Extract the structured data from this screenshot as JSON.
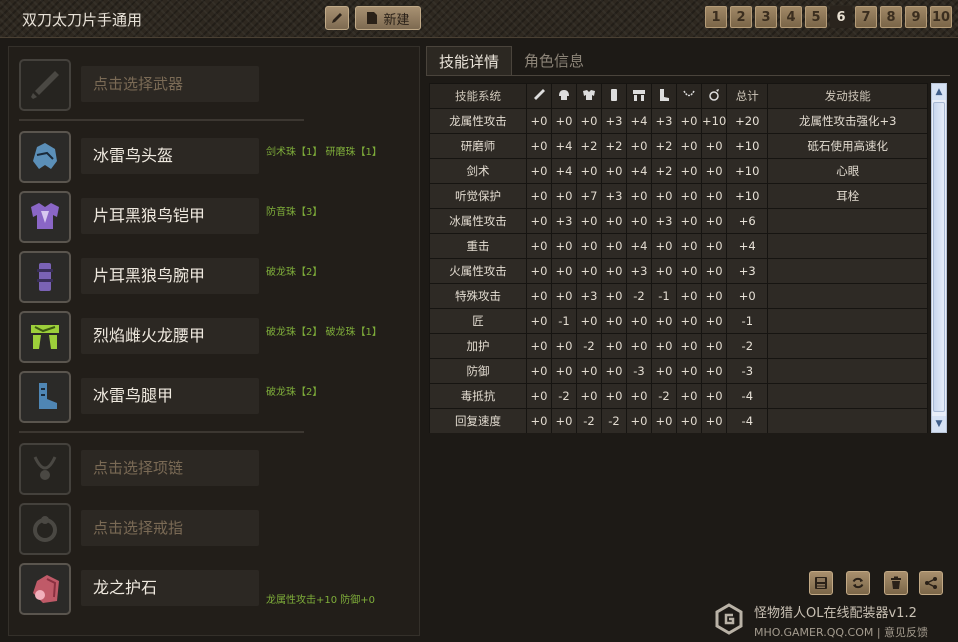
{
  "header": {
    "title": "双刀太刀片手通用",
    "new_label": "新建",
    "pages": [
      "1",
      "2",
      "3",
      "4",
      "5",
      "6",
      "7",
      "8",
      "9",
      "10"
    ],
    "active_page": "6"
  },
  "left": {
    "weapon": {
      "placeholder": "点击选择武器"
    },
    "armor": [
      {
        "name": "冰雷鸟头盔",
        "gems": "剑术珠【1】 研磨珠【1】",
        "color": "#5b8fb8"
      },
      {
        "name": "片耳黑狼鸟铠甲",
        "gems": "防音珠【3】",
        "color": "#8a66c6"
      },
      {
        "name": "片耳黑狼鸟腕甲",
        "gems": "破龙珠【2】",
        "color": "#7a62b5"
      },
      {
        "name": "烈焰雌火龙腰甲",
        "gems": "破龙珠【2】 破龙珠【1】",
        "color": "#9ccf3a"
      },
      {
        "name": "冰雷鸟腿甲",
        "gems": "破龙珠【2】",
        "color": "#4f86b4"
      }
    ],
    "necklace": {
      "placeholder": "点击选择项链"
    },
    "ring": {
      "placeholder": "点击选择戒指"
    },
    "charm": {
      "name": "龙之护石",
      "gems": "龙属性攻击+10 防御+0"
    }
  },
  "tabs": {
    "skills": "技能详情",
    "character": "角色信息"
  },
  "table": {
    "header_name": "技能系统",
    "header_total": "总计",
    "header_active": "发动技能",
    "rows": [
      {
        "name": "龙属性攻击",
        "vals": [
          "+0",
          "+0",
          "+0",
          "+3",
          "+4",
          "+3",
          "+0",
          "+10"
        ],
        "total": "+20",
        "active": "龙属性攻击强化+3"
      },
      {
        "name": "研磨师",
        "vals": [
          "+0",
          "+4",
          "+2",
          "+2",
          "+0",
          "+2",
          "+0",
          "+0"
        ],
        "total": "+10",
        "active": "砥石使用高速化"
      },
      {
        "name": "剑术",
        "vals": [
          "+0",
          "+4",
          "+0",
          "+0",
          "+4",
          "+2",
          "+0",
          "+0"
        ],
        "total": "+10",
        "active": "心眼"
      },
      {
        "name": "听觉保护",
        "vals": [
          "+0",
          "+0",
          "+7",
          "+3",
          "+0",
          "+0",
          "+0",
          "+0"
        ],
        "total": "+10",
        "active": "耳栓"
      },
      {
        "name": "冰属性攻击",
        "vals": [
          "+0",
          "+3",
          "+0",
          "+0",
          "+0",
          "+3",
          "+0",
          "+0"
        ],
        "total": "+6",
        "active": ""
      },
      {
        "name": "重击",
        "vals": [
          "+0",
          "+0",
          "+0",
          "+0",
          "+4",
          "+0",
          "+0",
          "+0"
        ],
        "total": "+4",
        "active": ""
      },
      {
        "name": "火属性攻击",
        "vals": [
          "+0",
          "+0",
          "+0",
          "+0",
          "+3",
          "+0",
          "+0",
          "+0"
        ],
        "total": "+3",
        "active": ""
      },
      {
        "name": "特殊攻击",
        "vals": [
          "+0",
          "+0",
          "+3",
          "+0",
          "-2",
          "-1",
          "+0",
          "+0"
        ],
        "total": "+0",
        "active": ""
      },
      {
        "name": "匠",
        "vals": [
          "+0",
          "-1",
          "+0",
          "+0",
          "+0",
          "+0",
          "+0",
          "+0"
        ],
        "total": "-1",
        "active": ""
      },
      {
        "name": "加护",
        "vals": [
          "+0",
          "+0",
          "-2",
          "+0",
          "+0",
          "+0",
          "+0",
          "+0"
        ],
        "total": "-2",
        "active": ""
      },
      {
        "name": "防御",
        "vals": [
          "+0",
          "+0",
          "+0",
          "+0",
          "-3",
          "+0",
          "+0",
          "+0"
        ],
        "total": "-3",
        "active": ""
      },
      {
        "name": "毒抵抗",
        "vals": [
          "+0",
          "-2",
          "+0",
          "+0",
          "+0",
          "-2",
          "+0",
          "+0"
        ],
        "total": "-4",
        "active": ""
      },
      {
        "name": "回复速度",
        "vals": [
          "+0",
          "+0",
          "-2",
          "-2",
          "+0",
          "+0",
          "+0",
          "+0"
        ],
        "total": "-4",
        "active": ""
      }
    ]
  },
  "brand": {
    "name": "怪物猎人OL在线配装器v1.2",
    "site": "MHO.GAMER.QQ.COM | 意见反馈"
  }
}
